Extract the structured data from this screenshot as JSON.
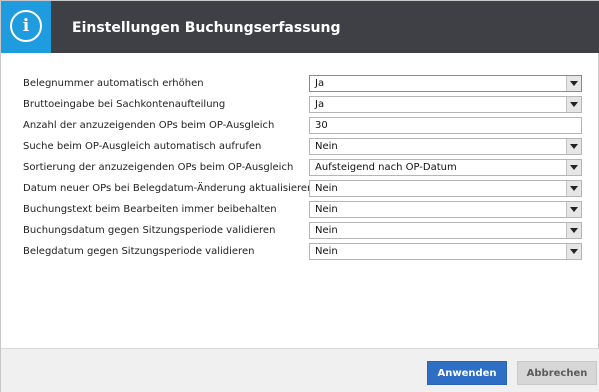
{
  "dialog": {
    "title": "Einstellungen Buchungserfassung",
    "icon": "info-icon"
  },
  "settings": [
    {
      "label": "Belegnummer automatisch erhöhen",
      "type": "select",
      "value": "Ja"
    },
    {
      "label": "Bruttoeingabe bei Sachkontenaufteilung",
      "type": "select",
      "value": "Ja"
    },
    {
      "label": "Anzahl der anzuzeigenden OPs beim OP-Ausgleich",
      "type": "text",
      "value": "30"
    },
    {
      "label": "Suche beim OP-Ausgleich automatisch aufrufen",
      "type": "select",
      "value": "Nein"
    },
    {
      "label": "Sortierung der anzuzeigenden OPs beim OP-Ausgleich",
      "type": "select",
      "value": "Aufsteigend nach OP-Datum"
    },
    {
      "label": "Datum neuer OPs bei Belegdatum-Änderung aktualisieren",
      "type": "select",
      "value": "Nein"
    },
    {
      "label": "Buchungstext beim Bearbeiten immer beibehalten",
      "type": "select",
      "value": "Nein"
    },
    {
      "label": "Buchungsdatum gegen Sitzungsperiode validieren",
      "type": "select",
      "value": "Nein"
    },
    {
      "label": "Belegdatum gegen Sitzungsperiode validieren",
      "type": "select",
      "value": "Nein"
    }
  ],
  "footer": {
    "apply_label": "Anwenden",
    "cancel_label": "Abbrechen"
  },
  "colors": {
    "titlebar": "#3f4045",
    "accent_icon": "#1f9be0",
    "primary_button": "#2e6ec5",
    "disabled_button": "#d7d7d7"
  }
}
